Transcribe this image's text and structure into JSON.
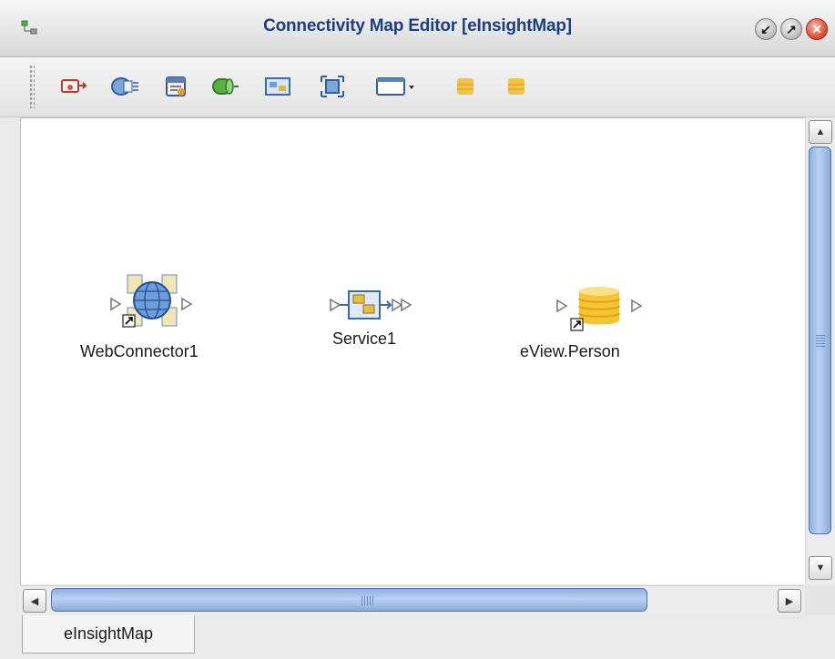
{
  "window": {
    "title": "Connectivity Map Editor [eInsightMap]",
    "controls": [
      "minimize-icon",
      "maximize-icon",
      "close-icon"
    ]
  },
  "toolbar": {
    "tools": [
      {
        "name": "external-application-tool",
        "icon": "external-app-icon"
      },
      {
        "name": "web-service-tool",
        "icon": "web-service-icon"
      },
      {
        "name": "scheduler-tool",
        "icon": "scheduler-icon"
      },
      {
        "name": "topic-queue-tool",
        "icon": "queue-icon"
      },
      {
        "name": "service-tool",
        "icon": "service-icon"
      },
      {
        "name": "composite-tool",
        "icon": "composite-icon"
      },
      {
        "name": "layout-dropdown-tool",
        "icon": "window-dropdown-icon"
      },
      {
        "name": "database-tool-1",
        "icon": "database-icon"
      },
      {
        "name": "database-tool-2",
        "icon": "database-icon"
      }
    ]
  },
  "canvas": {
    "nodes": [
      {
        "id": "webconnector",
        "label": "WebConnector1",
        "icon": "web-connector-icon"
      },
      {
        "id": "service",
        "label": "Service1",
        "icon": "service-icon"
      },
      {
        "id": "eview",
        "label": "eView.Person",
        "icon": "database-icon"
      }
    ]
  },
  "tabs": [
    {
      "label": "eInsightMap",
      "selected": true
    }
  ],
  "colors": {
    "title_text": "#1d3f7e",
    "scroll_thumb": "#9bbbe6",
    "close_button": "#e0553f"
  }
}
